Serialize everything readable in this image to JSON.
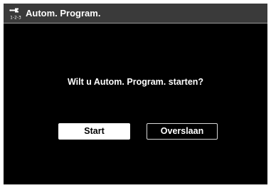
{
  "header": {
    "icon": "setup-wrench-icon",
    "icon_caption": "1-2-3",
    "title": "Autom. Program."
  },
  "dialog": {
    "question": "Wilt u Autom. Program. starten?",
    "buttons": {
      "start_label": "Start",
      "skip_label": "Overslaan"
    }
  },
  "colors": {
    "background": "#000000",
    "title_bar": "#3a3a3a",
    "text": "#ffffff",
    "selected_button_bg": "#ffffff",
    "selected_button_text": "#000000"
  }
}
